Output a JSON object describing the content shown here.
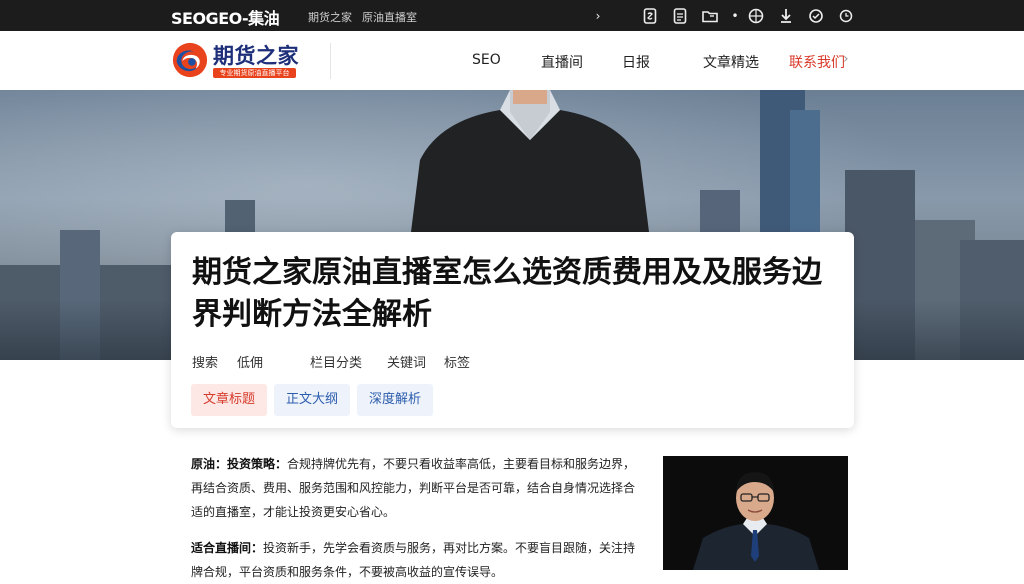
{
  "topbar": {
    "site_title": "SEOGEO-集油",
    "links": [
      "期货之家",
      "原油直播室"
    ],
    "icons": [
      "chevron-right-icon",
      "document-icon",
      "file-icon",
      "folder-icon",
      "dot-icon",
      "globe-icon",
      "download-icon",
      "settings-icon",
      "clock-icon"
    ]
  },
  "header": {
    "logo_name": "期货之家",
    "logo_tagline": "专业期货原油直播平台",
    "nav": [
      {
        "label": "SEO",
        "active": false
      },
      {
        "label": "直播间",
        "active": false
      },
      {
        "label": "日报",
        "active": false
      },
      {
        "label": "文章精选",
        "active": false
      },
      {
        "label": "联系我们",
        "active": true
      }
    ]
  },
  "article": {
    "title": "期货之家原油直播室怎么选资质费用及及服务边界判断方法全解析",
    "meta": [
      "搜索",
      "低佣",
      "栏目分类",
      "关键词",
      "标签"
    ],
    "tags": [
      "文章标题",
      "正文大纲",
      "深度解析"
    ]
  },
  "body": {
    "p1_lead": "原油：投资策略：",
    "p1_text": "合规持牌优先有，不要只看收益率高低，主要看目标和服务边界，再结合资质、费用、服务范围和风控能力，判断平台是否可靠，结合自身情况选择合适的直播室，才能让投资更安心省心。",
    "p2_lead": "适合直播间：",
    "p2_text": "投资新手，先学会看资质与服务，再对比方案。不要盲目跟随，关注持牌合规，平台资质和服务条件，不要被高收益的宣传误导。"
  },
  "colors": {
    "accent_red": "#d83a2a",
    "brand_blue": "#1e2f7a",
    "topbar_bg": "#1c1c1c"
  }
}
